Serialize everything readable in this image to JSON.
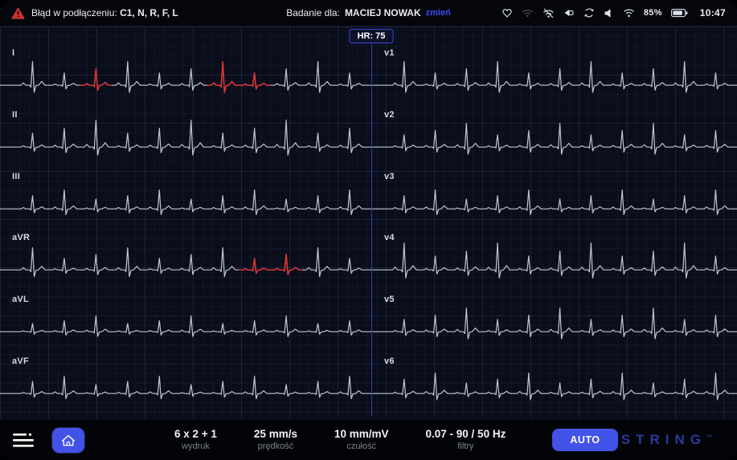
{
  "top_bar": {
    "error_prefix": "Błąd w podłączeniu:",
    "error_leads": "C1, N, R, F, L",
    "exam_prefix": "Badanie dla:",
    "patient_name": "MACIEJ NOWAK",
    "change_link": "zmień",
    "battery_percent": "85%",
    "time": "10:47",
    "status_icons": [
      "heart-icon",
      "signal-dim-icon",
      "wifi-off-icon",
      "plug-icon",
      "sync-icon",
      "volume-icon",
      "wifi-icon",
      "battery-icon"
    ]
  },
  "hr_badge": {
    "label": "HR: 75",
    "value": "75"
  },
  "ecg": {
    "trace_color": "#bfc4cf",
    "alert_color": "#d93434",
    "left_leads": [
      {
        "label": "I",
        "amp": 30,
        "red_beats": [
          2,
          6,
          7
        ]
      },
      {
        "label": "II",
        "amp": 34,
        "red_beats": []
      },
      {
        "label": "III",
        "amp": 24,
        "red_beats": []
      },
      {
        "label": "aVR",
        "amp": 28,
        "red_beats": [
          7,
          8
        ]
      },
      {
        "label": "aVL",
        "amp": 20,
        "red_beats": []
      },
      {
        "label": "aVF",
        "amp": 22,
        "red_beats": []
      }
    ],
    "right_leads": [
      {
        "label": "v1",
        "amp": 30,
        "red_beats": []
      },
      {
        "label": "v2",
        "amp": 30,
        "red_beats": []
      },
      {
        "label": "v3",
        "amp": 24,
        "red_beats": []
      },
      {
        "label": "v4",
        "amp": 34,
        "red_beats": []
      },
      {
        "label": "v5",
        "amp": 30,
        "red_beats": []
      },
      {
        "label": "v6",
        "amp": 26,
        "red_beats": []
      }
    ]
  },
  "bottom_bar": {
    "print_value": "6 x 2 + 1",
    "print_label": "wydruk",
    "speed_value": "25 mm/s",
    "speed_label": "prędkość",
    "sens_value": "10 mm/mV",
    "sens_label": "czułość",
    "filter_value": "0.07 - 90 / 50 Hz",
    "filter_label": "filtry",
    "auto_button": "AUTO",
    "brand": "STRING",
    "brand_mark": "™",
    "icons": [
      "menu-icon",
      "home-icon"
    ]
  },
  "colors": {
    "accent": "#4353e8",
    "link": "#3d4df0",
    "alert": "#d93434",
    "divider": "#3a48d8"
  }
}
